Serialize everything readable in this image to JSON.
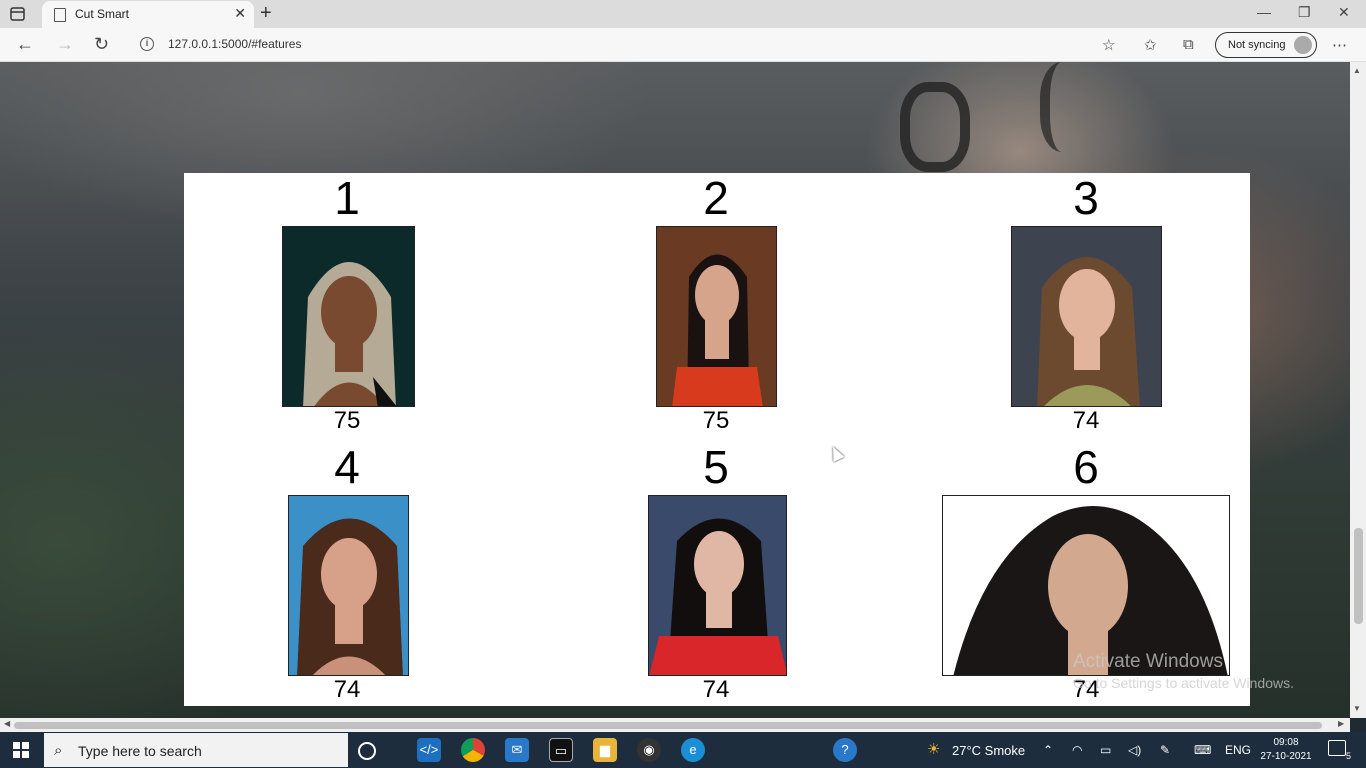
{
  "browser": {
    "tab_title": "Cut Smart",
    "url": "127.0.0.1:5000/#features",
    "sync_label": "Not syncing"
  },
  "results": [
    {
      "rank": "1",
      "score": "75",
      "bg": "#0d2a2a",
      "hair": "#b5aa95",
      "skin": "#7a4a30",
      "top": "#101010"
    },
    {
      "rank": "2",
      "score": "75",
      "bg": "#6b3a22",
      "hair": "#1a1210",
      "skin": "#d6a48a",
      "top": "#d83a1e"
    },
    {
      "rank": "3",
      "score": "74",
      "bg": "#3d4450",
      "hair": "#6b4a30",
      "skin": "#e2b49c",
      "top": "#9c9a5a"
    },
    {
      "rank": "4",
      "score": "74",
      "bg": "#3b90c8",
      "hair": "#4a2a1a",
      "skin": "#d7a088",
      "top": "#c9907a"
    },
    {
      "rank": "5",
      "score": "74",
      "bg": "#3a4a6a",
      "hair": "#120e0e",
      "skin": "#e0b6a4",
      "top": "#d8262a"
    },
    {
      "rank": "6",
      "score": "74",
      "bg": "#ffffff",
      "hair": "#1a1616",
      "skin": "#d2a98f",
      "top": "#ffffff"
    }
  ],
  "watermark": {
    "line1": "Activate Windows",
    "line2": "Go to Settings to activate Windows."
  },
  "taskbar": {
    "search_placeholder": "Type here to search",
    "weather": "27°C  Smoke",
    "language": "ENG",
    "time": "09:08",
    "date": "27-10-2021",
    "notification_count": "5"
  }
}
